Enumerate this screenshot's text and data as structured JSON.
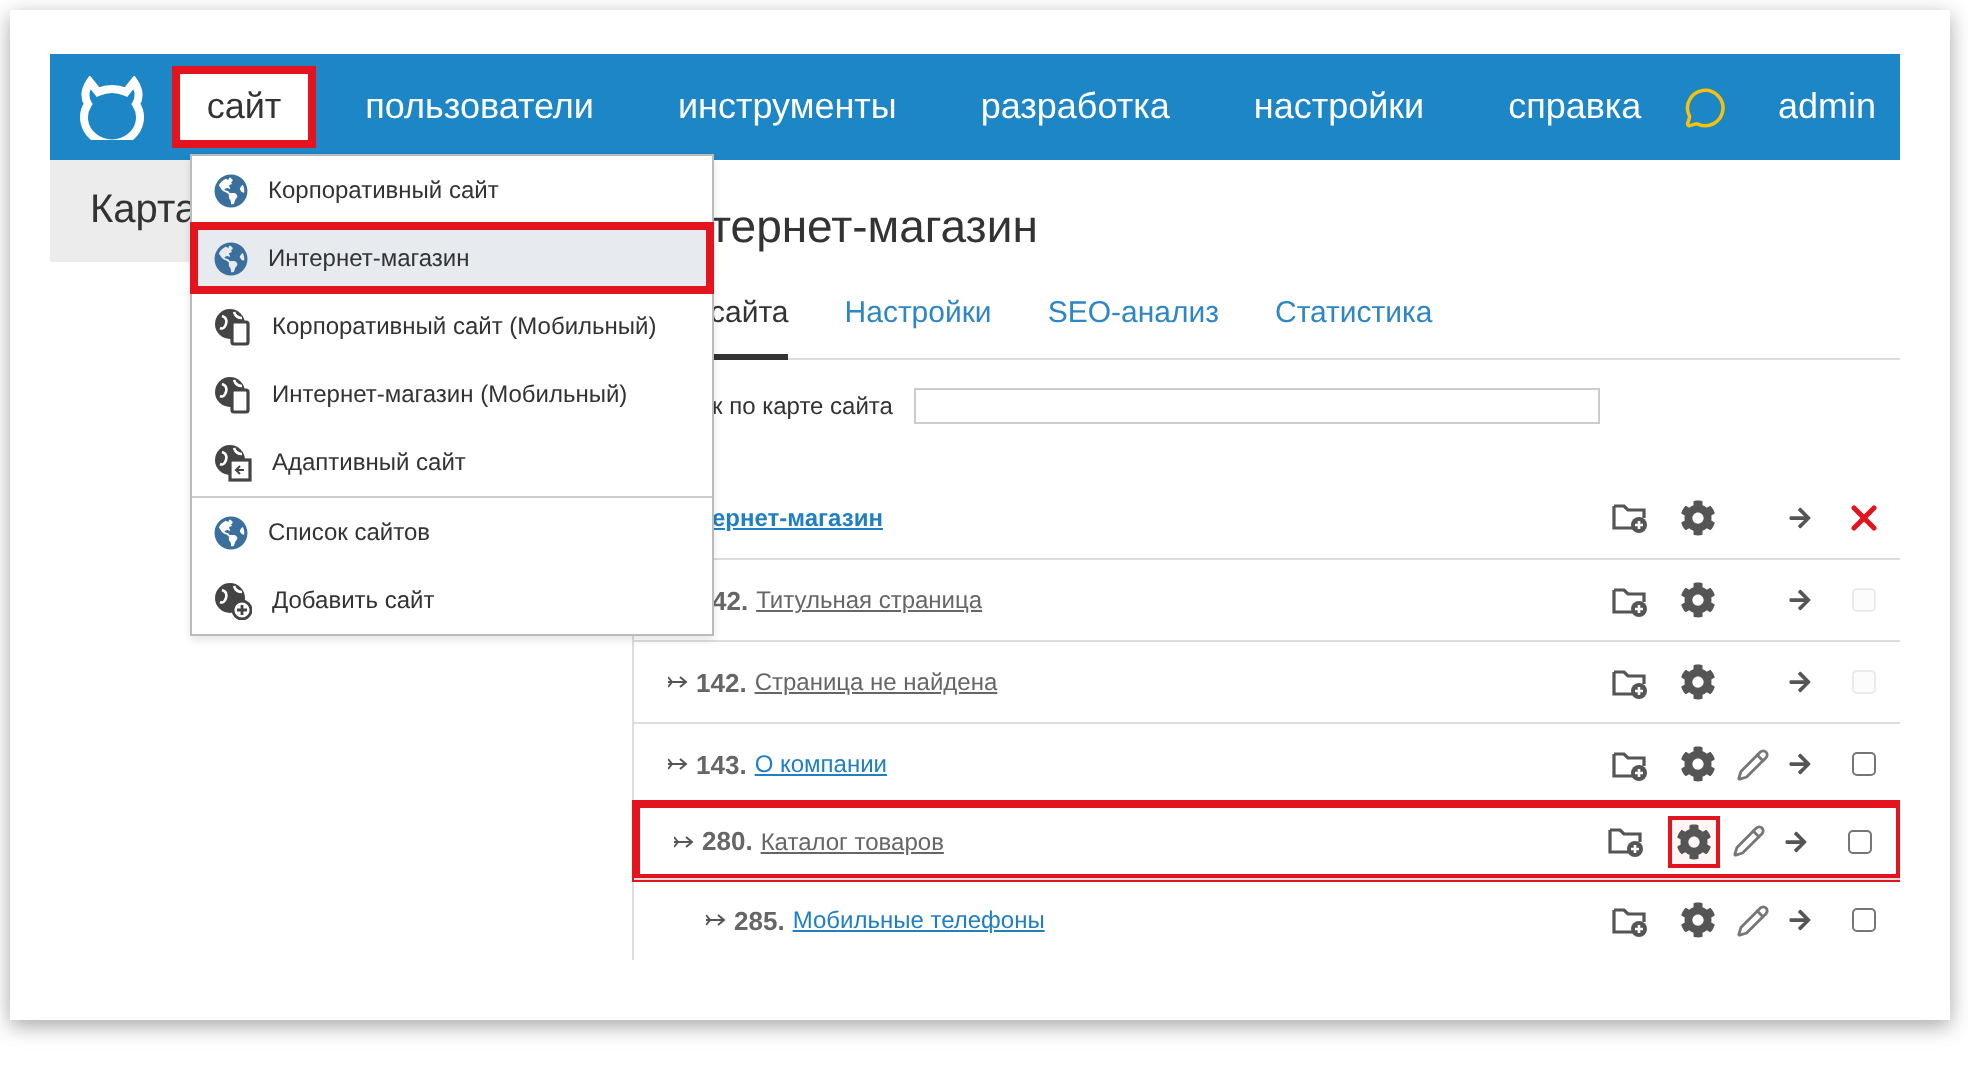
{
  "header": {
    "nav": [
      {
        "label": "сайт",
        "selected": true,
        "highlighted": true
      },
      {
        "label": "пользователи",
        "selected": false,
        "highlighted": false
      },
      {
        "label": "инструменты",
        "selected": false,
        "highlighted": false
      },
      {
        "label": "разработка",
        "selected": false,
        "highlighted": false
      },
      {
        "label": "настройки",
        "selected": false,
        "highlighted": false
      },
      {
        "label": "справка",
        "selected": false,
        "highlighted": false
      }
    ],
    "user": "admin"
  },
  "sidebar": {
    "title": "Карта"
  },
  "dropdown": {
    "sections": [
      [
        {
          "label": "Корпоративный сайт",
          "kind": "globe",
          "selected": false,
          "highlighted": false
        },
        {
          "label": "Интернет-магазин",
          "kind": "globe",
          "selected": true,
          "highlighted": true
        },
        {
          "label": "Корпоративный сайт (Мобильный)",
          "kind": "mobile",
          "selected": false,
          "highlighted": false
        },
        {
          "label": "Интернет-магазин (Мобильный)",
          "kind": "mobile",
          "selected": false,
          "highlighted": false
        },
        {
          "label": "Адаптивный сайт",
          "kind": "adaptive",
          "selected": false,
          "highlighted": false
        }
      ],
      [
        {
          "label": "Список сайтов",
          "kind": "globe",
          "selected": false,
          "highlighted": false
        },
        {
          "label": "Добавить сайт",
          "kind": "add",
          "selected": false,
          "highlighted": false
        }
      ]
    ]
  },
  "page": {
    "title": "тернет-магазин",
    "tabs": [
      {
        "label": "сайта",
        "selected": true
      },
      {
        "label": "Настройки",
        "selected": false
      },
      {
        "label": "SEO-анализ",
        "selected": false
      },
      {
        "label": "Статистика",
        "selected": false
      }
    ],
    "search": {
      "label": "к по карте сайта"
    },
    "root": {
      "title": "ернет-магазин"
    },
    "rows": [
      {
        "number": "42.",
        "title": "Титульная страница",
        "arrow": false,
        "active": false,
        "editable": false,
        "disabled": true,
        "highlighted": false,
        "gear_highlighted": false
      },
      {
        "number": "142.",
        "title": "Страница не найдена",
        "arrow": true,
        "active": false,
        "editable": false,
        "disabled": true,
        "highlighted": false,
        "gear_highlighted": false
      },
      {
        "number": "143.",
        "title": "О компании",
        "arrow": true,
        "active": true,
        "editable": true,
        "disabled": false,
        "highlighted": false,
        "gear_highlighted": false
      },
      {
        "number": "280.",
        "title": "Каталог товаров",
        "arrow": true,
        "active": false,
        "editable": true,
        "disabled": false,
        "highlighted": true,
        "gear_highlighted": true,
        "children": [
          {
            "number": "285.",
            "title": "Мобильные телефоны",
            "arrow": true,
            "active": true,
            "editable": true,
            "disabled": false,
            "highlighted": false,
            "gear_highlighted": false
          }
        ]
      }
    ]
  }
}
